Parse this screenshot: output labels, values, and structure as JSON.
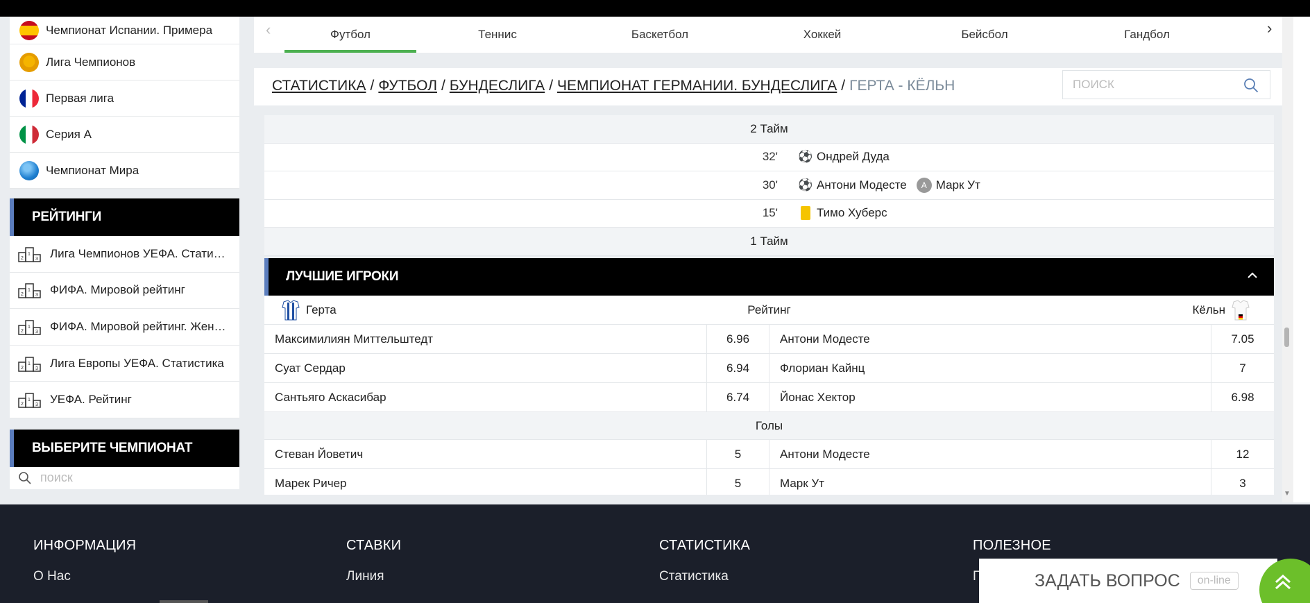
{
  "sidebar": {
    "leagues": [
      {
        "label": "Чемпионат Испании. Примера",
        "flag": "spain"
      },
      {
        "label": "Лига Чемпионов",
        "flag": "cup"
      },
      {
        "label": "Первая лига",
        "flag": "france"
      },
      {
        "label": "Серия А",
        "flag": "italy"
      },
      {
        "label": "Чемпионат Мира",
        "flag": "world"
      }
    ],
    "ratings_title": "РЕЙТИНГИ",
    "ratings": [
      "Лига Чемпионов УЕФА. Статистика",
      "ФИФА. Мировой рейтинг",
      "ФИФА. Мировой рейтинг. Женщины",
      "Лига Европы УЕФА. Статистика",
      "УЕФА. Рейтинг"
    ],
    "choose_title": "ВЫБЕРИТЕ ЧЕМПИОНАТ",
    "search_placeholder": "поиск"
  },
  "sport_tabs": [
    "Футбол",
    "Теннис",
    "Баскетбол",
    "Хоккей",
    "Бейсбол",
    "Гандбол"
  ],
  "active_tab": "Футбол",
  "breadcrumb": {
    "items": [
      "СТАТИСТИКА",
      "ФУТБОЛ",
      "БУНДЕСЛИГА",
      "ЧЕМПИОНАТ ГЕРМАНИИ. БУНДЕСЛИГА"
    ],
    "current": "ГЕРТА - КЁЛЬН",
    "separator": "/"
  },
  "search": {
    "placeholder": "ПОИСК"
  },
  "events": {
    "half2_label": "2 Тайм",
    "half1_label": "1 Тайм",
    "items": [
      {
        "minute": "32'",
        "type": "goal",
        "player": "Ондрей Дуда",
        "assist": ""
      },
      {
        "minute": "30'",
        "type": "goal",
        "player": "Антони Модесте",
        "assist": "Марк Ут"
      },
      {
        "minute": "15'",
        "type": "yellow-card",
        "player": "Тимо Хуберс",
        "assist": ""
      }
    ]
  },
  "best_players": {
    "title": "ЛУЧШИЕ ИГРОКИ",
    "home_team": "Герта",
    "away_team": "Кёльн",
    "rating_label": "Рейтинг",
    "rating_rows": [
      {
        "home": "Максимилиян Миттельштедт",
        "home_val": "6.96",
        "away": "Антони Модесте",
        "away_val": "7.05"
      },
      {
        "home": "Суат Сердар",
        "home_val": "6.94",
        "away": "Флориан Кайнц",
        "away_val": "7"
      },
      {
        "home": "Сантьяго Аскасибар",
        "home_val": "6.74",
        "away": "Йонас Хектор",
        "away_val": "6.98"
      }
    ],
    "goals_label": "Голы",
    "goal_rows": [
      {
        "home": "Стеван Йоветич",
        "home_val": "5",
        "away": "Антони Модесте",
        "away_val": "12"
      },
      {
        "home": "Марек Ричер",
        "home_val": "5",
        "away": "Марк Ут",
        "away_val": "3"
      }
    ]
  },
  "footer": {
    "columns": [
      {
        "title": "ИНФОРМАЦИЯ",
        "link": "О Нас"
      },
      {
        "title": "СТАВКИ",
        "link": "Линия"
      },
      {
        "title": "СТАТИСТИКА",
        "link": "Статистика"
      },
      {
        "title": "ПОЛЕЗНОЕ",
        "link": "П"
      }
    ]
  },
  "ask": {
    "label": "ЗАДАТЬ ВОПРОС",
    "status": "on-line"
  },
  "colors": {
    "accent_green": "#4cb050",
    "header_bar": "#5b7dbd",
    "footer_bg": "#1b1f2a",
    "ask_green": "#6cbf2a"
  }
}
